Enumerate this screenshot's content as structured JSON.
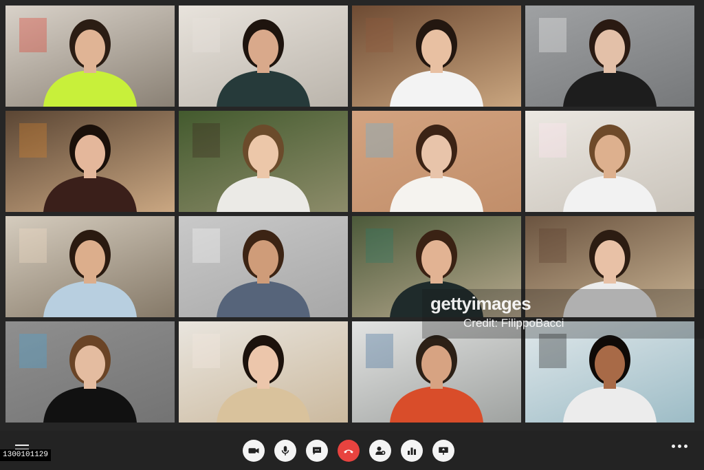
{
  "participants": [
    {
      "bg1": "#d9d2c9",
      "bg2": "#8a8175",
      "skin": "#e0b495",
      "hair": "#2b1d14",
      "shirt": "#c8f03a",
      "accent": "#dc3b2f"
    },
    {
      "bg1": "#e8e3dc",
      "bg2": "#bab4ab",
      "skin": "#d9a98b",
      "hair": "#1e140e",
      "shirt": "#263a3a",
      "accent": "#e7e2dc"
    },
    {
      "bg1": "#6e4b33",
      "bg2": "#c9a57f",
      "skin": "#e8c0a2",
      "hair": "#231710",
      "shirt": "#f3f3f3",
      "accent": "#8e5a3b"
    },
    {
      "bg1": "#9fa1a3",
      "bg2": "#76787a",
      "skin": "#e3c0a8",
      "hair": "#2a1a12",
      "shirt": "#1d1d1d",
      "accent": "#f2f2f2"
    },
    {
      "bg1": "#5b4634",
      "bg2": "#caa782",
      "skin": "#e4b79b",
      "hair": "#1a100a",
      "shirt": "#3a1f1a",
      "accent": "#d8832d"
    },
    {
      "bg1": "#435a2e",
      "bg2": "#8d8c6a",
      "skin": "#ecc7a9",
      "hair": "#6b4b2b",
      "shirt": "#ebeae6",
      "accent": "#3d2c20"
    },
    {
      "bg1": "#d3a380",
      "bg2": "#c18e6a",
      "skin": "#e8c4aa",
      "hair": "#3b2315",
      "shirt": "#f5f3ef",
      "accent": "#6bb1d8"
    },
    {
      "bg1": "#ece8e2",
      "bg2": "#c9c3ba",
      "skin": "#ddb08e",
      "hair": "#6e4a2a",
      "shirt": "#f2f2f2",
      "accent": "#ffe5f0"
    },
    {
      "bg1": "#d5ccbe",
      "bg2": "#857968",
      "skin": "#dcae8c",
      "hair": "#2a1a10",
      "shirt": "#b8cfe0",
      "accent": "#f0dcc6"
    },
    {
      "bg1": "#c9c9c9",
      "bg2": "#a7a7a7",
      "skin": "#cf9c79",
      "hair": "#3c2414",
      "shirt": "#56647a",
      "accent": "#f5f5f5"
    },
    {
      "bg1": "#4c5a3a",
      "bg2": "#b7a98e",
      "skin": "#e2b393",
      "hair": "#3a2214",
      "shirt": "#1f2b2b",
      "accent": "#2f7c68"
    },
    {
      "bg1": "#6b5440",
      "bg2": "#c9b393",
      "skin": "#e8c1a6",
      "hair": "#2c1c12",
      "shirt": "#ececec",
      "accent": "#5e4232"
    },
    {
      "bg1": "#8f8f8f",
      "bg2": "#737373",
      "skin": "#e4bca0",
      "hair": "#6a4426",
      "shirt": "#111111",
      "accent": "#4aa6d6"
    },
    {
      "bg1": "#e9e5de",
      "bg2": "#cbb99e",
      "skin": "#ecc6ab",
      "hair": "#1c120c",
      "shirt": "#d9c29c",
      "accent": "#f3e7e0"
    },
    {
      "bg1": "#e2e3e2",
      "bg2": "#9fa2a0",
      "skin": "#d7a382",
      "hair": "#2c2016",
      "shirt": "#d94d2a",
      "accent": "#3f6d9a"
    },
    {
      "bg1": "#dfe7ea",
      "bg2": "#9dbcc6",
      "skin": "#a86a47",
      "hair": "#0f0a07",
      "shirt": "#ececec",
      "accent": "#222222"
    }
  ],
  "controls": [
    {
      "name": "camera-button",
      "icon": "camera-icon"
    },
    {
      "name": "microphone-button",
      "icon": "microphone-icon"
    },
    {
      "name": "chat-button",
      "icon": "chat-icon"
    },
    {
      "name": "end-call-button",
      "icon": "phone-hangup-icon"
    },
    {
      "name": "add-participant-button",
      "icon": "add-user-icon"
    },
    {
      "name": "stats-button",
      "icon": "bar-chart-icon"
    },
    {
      "name": "share-screen-button",
      "icon": "screen-share-icon"
    }
  ],
  "watermark": {
    "brand": "gettyimages",
    "credit": "Credit: FilippoBacci"
  },
  "image_id": "1300101129",
  "colors": {
    "toolbar": "#232323",
    "end_call": "#e8433f",
    "control_bg": "#f4f4f4"
  }
}
